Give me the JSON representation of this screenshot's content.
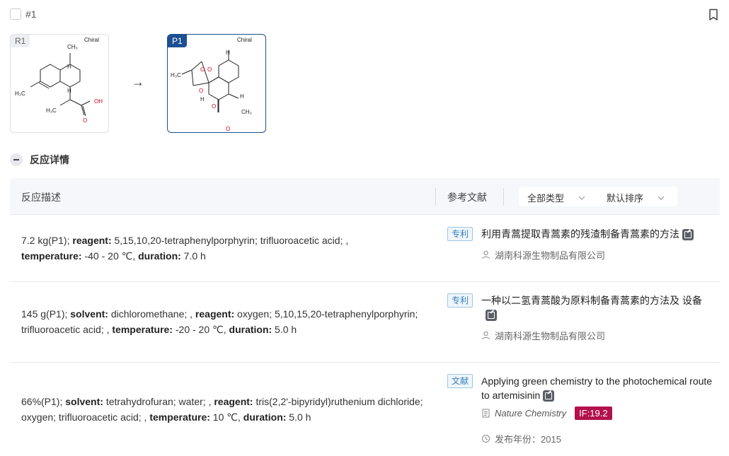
{
  "header": {
    "reaction_id": "#1"
  },
  "scheme": {
    "reactant": {
      "tag": "R1",
      "stereo_label": "Chiral"
    },
    "product": {
      "tag": "P1",
      "stereo_label": "Chiral"
    },
    "arrow": "→"
  },
  "section": {
    "title": "反应详情"
  },
  "table": {
    "col_description": "反应描述",
    "col_references": "参考文献",
    "filter_type": "全部类型",
    "filter_sort": "默认排序"
  },
  "rows": [
    {
      "desc": {
        "p1": "7.2 kg(P1); ",
        "k1": "reagent:",
        "v1": " 5,15,10,20-tetraphenylporphyrin; trifluoroacetic acid; , ",
        "k2": "temperature:",
        "v2": " -40 - 20 ℃, ",
        "k3": "duration:",
        "v3": " 7.0 h"
      },
      "ref_type": "专利",
      "ref_title": "利用青蒿提取青蒿素的残渣制备青蒿素的方法",
      "assignee": "湖南科源生物制品有限公司"
    },
    {
      "desc": {
        "p1": "145 g(P1); ",
        "k0": "solvent:",
        "v0": " dichloromethane; , ",
        "k1": "reagent:",
        "v1": " oxygen; 5,10,15,20-tetraphenylporphyrin; trifluoroacetic acid; , ",
        "k2": "temperature:",
        "v2": " -20 - 20 ℃, ",
        "k3": "duration:",
        "v3": " 5.0 h"
      },
      "ref_type": "专利",
      "ref_title": "一种以二氢青蒿酸为原料制备青蒿素的方法及 设备",
      "assignee": "湖南科源生物制品有限公司"
    },
    {
      "desc": {
        "p1": "66%(P1); ",
        "k0": "solvent:",
        "v0": " tetrahydrofuran; water; , ",
        "k1": "reagent:",
        "v1": " tris(2,2'-bipyridyl)ruthenium dichloride; oxygen; trifluoroacetic acid; , ",
        "k2": "temperature:",
        "v2": " 10 ℃, ",
        "k3": "duration:",
        "v3": " 5.0 h"
      },
      "ref_type": "文献",
      "ref_title": "Applying green chemistry to the photochemical route to artemisinin",
      "journal": "Nature Chemistry",
      "impact_factor": "IF:19.2",
      "year_label": "发布年份：",
      "year": "2015"
    }
  ],
  "colors": {
    "product_border": "#1d4f91",
    "if_badge": "#b3124c",
    "badge_blue": "#3a7fb8"
  }
}
